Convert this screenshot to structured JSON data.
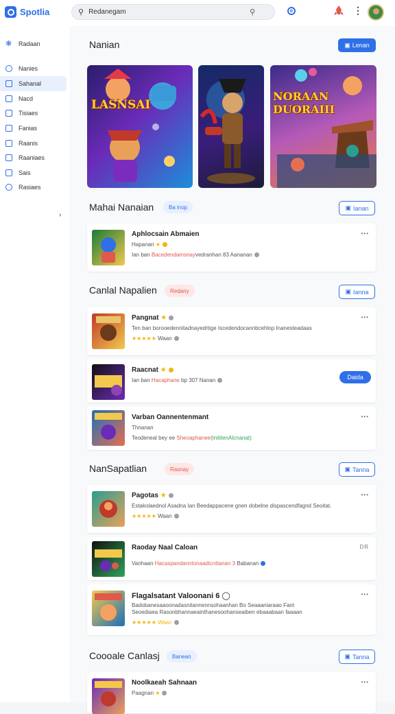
{
  "app": {
    "name": "Spotlia"
  },
  "search": {
    "value": "Redanegam"
  },
  "sidebar": {
    "items": [
      {
        "label": "Radaan"
      },
      {
        "label": "Nanies"
      },
      {
        "label": "Sahanal"
      },
      {
        "label": "Nacd"
      },
      {
        "label": "Tisiaes"
      },
      {
        "label": "Fanias"
      },
      {
        "label": "Raanis"
      },
      {
        "label": "Raaniaes"
      },
      {
        "label": "Sais"
      },
      {
        "label": "Rasiaes"
      }
    ]
  },
  "hero": {
    "title": "Nanian",
    "button": "Lenan",
    "banners": [
      {
        "caption": "LASNSAI"
      },
      {
        "caption": ""
      },
      {
        "caption": "NORAAN DUORAIII"
      }
    ]
  },
  "sections": [
    {
      "title": "Mahai Nanaian",
      "chip": "Ba inop",
      "button": "Ianan",
      "cards": [
        {
          "title": "Aphlocsain Abmaien",
          "line2": "Hapanan",
          "line3_pre": "Ian ban ",
          "line3_hl": "Bacedendamsnay",
          "line3_post": "vedranhan 83 Aananan",
          "kebab": "•••"
        }
      ]
    },
    {
      "title": "Canlal Napalien",
      "chip": "Redany",
      "button": "Ianna",
      "cards": [
        {
          "title": "Pangnat",
          "line2": "Ten ban borooedennitadnayedrtige Iscedendocannbcehlop Inanesteadaas",
          "line3_pre": "★★★★★ ",
          "line3_hl": "",
          "line3_post": "Waan",
          "kebab": "•••"
        },
        {
          "title": "Raacnat",
          "line2": "",
          "line3_pre": "Ian ban ",
          "line3_hl": "Hacaphane",
          "line3_post": " bp 307 Nanan",
          "kebab": "",
          "cta": "Daida"
        },
        {
          "title": "Varban Oannentenmant",
          "line2": "Thnanan",
          "line3_pre": "Teodeneal bey ee ",
          "line3_hl": "Sheoaphanee",
          "line3_post": "(lnititenAlcnanat)",
          "kebab": "•••"
        }
      ]
    },
    {
      "title": "NanSapatlian",
      "chip": "Rasnay",
      "button": "Tanna",
      "cards": [
        {
          "title": "Pagotas",
          "line2": "Estakolaednol Asadna Ian Beedappacene gnen dobelne dispascendfagnd Seoitat.",
          "line3_pre": "★★★★★ ",
          "line3_hl": "",
          "line3_post": "Waan",
          "kebab": "•••"
        },
        {
          "title": "Raoday Naal Caloan",
          "line2": "",
          "line3_pre": "Vanhaan ",
          "line3_hl": "Hacaspandanntonaadicnttanan 3",
          "line3_post": "Babanan",
          "kebab": "DR"
        },
        {
          "title": "Flagalsatant Valoonani 6",
          "line2": "Badobanesaaoonadasnitannennsohaanhan Bo Seaaaniaraao Fant",
          "line3_pre": "Seoediaea Rasonbhannaeainthanesoohanseaiben ebaaabaan faaaan",
          "line3_hl": "",
          "line3_post": "",
          "line4": "★★★★★ Waan",
          "kebab": "•••"
        }
      ]
    },
    {
      "title": "Coooale Canlasj",
      "chip": "Banean",
      "button": "Tanna",
      "cards": [
        {
          "title": "Noolkaeah Sahnaan",
          "line2": "Paagnan",
          "line3_pre": "",
          "line3_hl": "",
          "line3_post": "",
          "kebab": "•••"
        }
      ]
    }
  ]
}
